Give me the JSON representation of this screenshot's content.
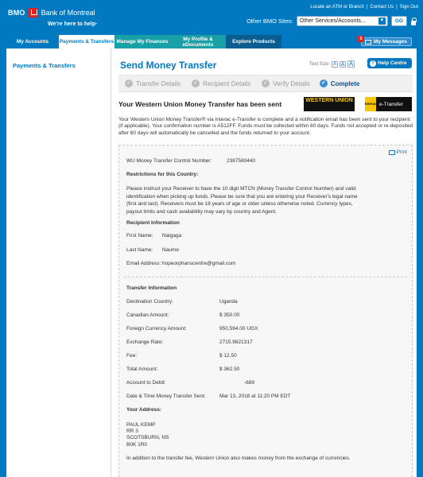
{
  "header": {
    "brand_short": "BMO",
    "brand_name": "Bank of Montreal",
    "tagline": "We're here to help·",
    "top_links": [
      "Locate an ATM or Branch",
      "|",
      "Contact Us",
      "|",
      "Sign Out"
    ],
    "sites_label": "Other BMO Sites:",
    "sites_selected": "Other Services/Accounts...",
    "go_label": "GO"
  },
  "nav": {
    "tabs": [
      {
        "label": "My Accounts"
      },
      {
        "label": "Payments & Transfers"
      },
      {
        "label": "Manage My Finances"
      },
      {
        "label": "My Profile & eDocuments"
      },
      {
        "label": "Explore Products"
      }
    ],
    "messages_label": "My Messages",
    "messages_count": "5"
  },
  "sidebar": {
    "item": "Payments & Transfers"
  },
  "page": {
    "title": "Send Money Transfer",
    "text_size_label": "Text Size:",
    "text_size_options": [
      "A",
      "A",
      "A"
    ],
    "help_label": "Help Centre",
    "steps": [
      "Transfer Details",
      "Recipient Details",
      "Verify Details",
      "Complete"
    ],
    "sent_heading": "Your Western Union Money Transfer has been sent",
    "wu_logo": "WESTERN UNION",
    "interac_logo": "Interac",
    "etransfer_logo": "e-Transfer",
    "intro": "Your Western Union Money Transfer® via Interac e-Transfer is complete and a notification email has been sent to your recipient (if applicable). Your confirmation number is A512FF. Funds must be collected within 60 days. Funds not accepted or re-deposited after 60 days will automatically be cancelled and the funds returned to your account."
  },
  "details": {
    "print_label": "Print",
    "mtcn_label": "WU Money Transfer Control Number:",
    "mtcn_value": "2387580440",
    "restrictions_heading": "Restrictions for this Country:",
    "restrictions_text": "Please instruct your Receiver to have the 10 digit MTCN (Money Transfer Control Number) and valid identification when picking up funds. Please be sure that you are entering your Receiver's legal name (first and last). Receivers must be 18 years of age or older unless otherwise noted. Currency types, payout limits and cash availability may vary by country and Agent.",
    "recipient_heading": "Recipient Information",
    "first_name_label": "First Name:",
    "first_name_value": "Naigaga",
    "last_name_label": "Last Name:",
    "last_name_value": "Naume",
    "email_label": "Email Address:",
    "email_value": "hopeorphanscentre@gmail.com",
    "transfer_heading": "Transfer Information",
    "country_label": "Destination Country:",
    "country_value": "Uganda",
    "cad_label": "Canadian Amount:",
    "cad_value": "$ 350.00",
    "fx_label": "Foreign Currency Amount:",
    "fx_value": "950,594.00 UGX",
    "rate_label": "Exchange Rate:",
    "rate_value": "2715.9821317",
    "fee_label": "Fee:",
    "fee_value": "$ 12.50",
    "total_label": "Total Amount:",
    "total_value": "$ 362.50",
    "debit_label": "Account to Debit:",
    "debit_value": "-689",
    "datetime_label": "Date & Time Money Transfer Sent:",
    "datetime_value": "Mar 13, 2018 at 11:20 PM EDT",
    "address_heading": "Your Address:",
    "address_lines": [
      "PAUL KEMP",
      "RR 3",
      "SCOTSBURN, NS",
      "B0K 1R0"
    ],
    "footer_note": "In addition to the transfer fee, Western Union also makes money from the exchange of currencies."
  },
  "colors": {
    "brand_blue": "#0079c1",
    "teal_tab": "#18a0a6",
    "alert_red": "#e2211c",
    "wu_yellow": "#f7c600"
  }
}
